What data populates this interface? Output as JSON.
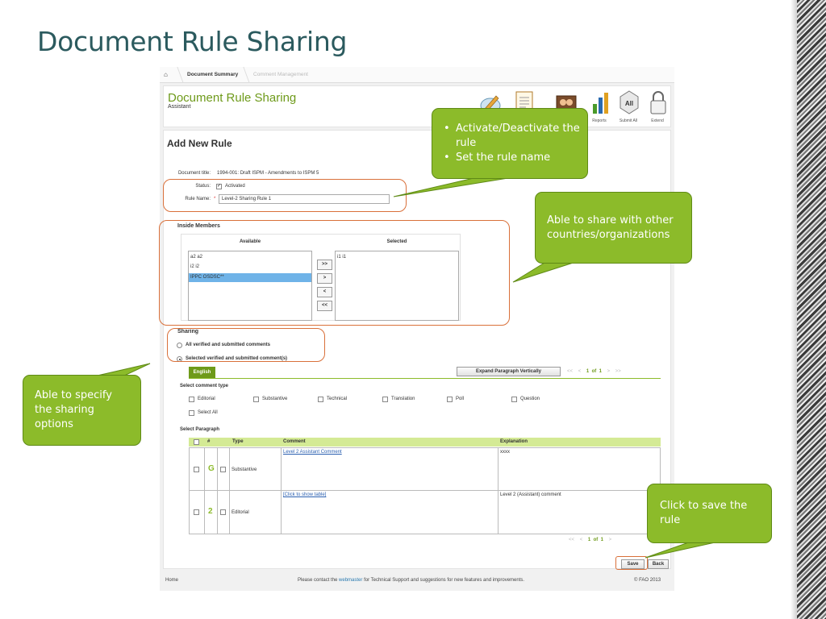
{
  "slide": {
    "title": "Document Rule Sharing"
  },
  "breadcrumb": {
    "home_icon": "home-icon",
    "items": [
      "Document Summary",
      "Comment Management"
    ]
  },
  "header": {
    "title": "Document Rule Sharing",
    "subtitle": "Assistant"
  },
  "toolbar": [
    {
      "icon": "pencil-icon",
      "label": ""
    },
    {
      "icon": "document-icon",
      "label": ""
    },
    {
      "icon": "people-icon",
      "label": ""
    },
    {
      "icon": "reports-icon",
      "label": "Reports"
    },
    {
      "icon": "submit-all-icon",
      "label": "Submit All",
      "badge": "All"
    },
    {
      "icon": "lock-icon",
      "label": "Extend"
    }
  ],
  "form": {
    "heading": "Add New Rule",
    "doc_title_label": "Document title:",
    "doc_title_value": "1994-001: Draft ISPM - Amendments to ISPM 5",
    "status_label": "Status:",
    "status_value": "Activated",
    "rule_name_label": "Rule Name:",
    "rule_name_required": "*",
    "rule_name_value": "Level-2 Sharing Rule 1"
  },
  "members": {
    "title": "Inside Members",
    "available_label": "Available",
    "selected_label": "Selected",
    "available": [
      "a2 a2",
      "i2 i2",
      "IPPC OSDSC**"
    ],
    "selected": [
      "i1 i1"
    ],
    "buttons": [
      ">>",
      ">",
      "<",
      "<<"
    ]
  },
  "sharing": {
    "title": "Sharing",
    "options": [
      "All verified and submitted comments",
      "Selected verified and submitted comment(s)"
    ],
    "selected_index": 1
  },
  "comments": {
    "language_tab": "English",
    "expand_button": "Expand Paragraph Vertically",
    "pager": {
      "first": "<<",
      "prev": "<",
      "page": "1",
      "of": "of",
      "total": "1",
      "next": ">",
      "last": ">>"
    },
    "type_heading": "Select comment type",
    "types": [
      "Editorial",
      "Substantive",
      "Technical",
      "Translation",
      "Poll",
      "Question"
    ],
    "select_all": "Select All",
    "paragraph_heading": "Select Paragraph",
    "columns": {
      "number": "#",
      "type": "Type",
      "comment": "Comment",
      "explanation": "Explanation"
    },
    "rows": [
      {
        "number": "G",
        "type": "Substantive",
        "comment": "Level 2 Assistant Comment",
        "explanation": "xxxx"
      },
      {
        "number": "2",
        "type": "Editorial",
        "comment": "[Click to show table]",
        "explanation": "Level 2 (Assistant) comment"
      }
    ]
  },
  "actions": {
    "save": "Save",
    "back": "Back"
  },
  "footer": {
    "home": "Home",
    "contact_pre": "Please contact the",
    "contact_link": "webmaster",
    "contact_post": "for Technical Support and suggestions for new features and improvements.",
    "copyright": "© FAO 2013"
  },
  "callouts": {
    "activate": [
      "Activate/Deactivate the rule",
      "Set the rule name"
    ],
    "share": "Able to share with other countries/organizations",
    "specify": "Able to specify the sharing options",
    "save": "Click to save the rule"
  },
  "colors": {
    "title": "#2b5a5e",
    "accent_green": "#8cbb2a",
    "highlight": "#d9703a",
    "header_green": "#6e9a1a"
  }
}
